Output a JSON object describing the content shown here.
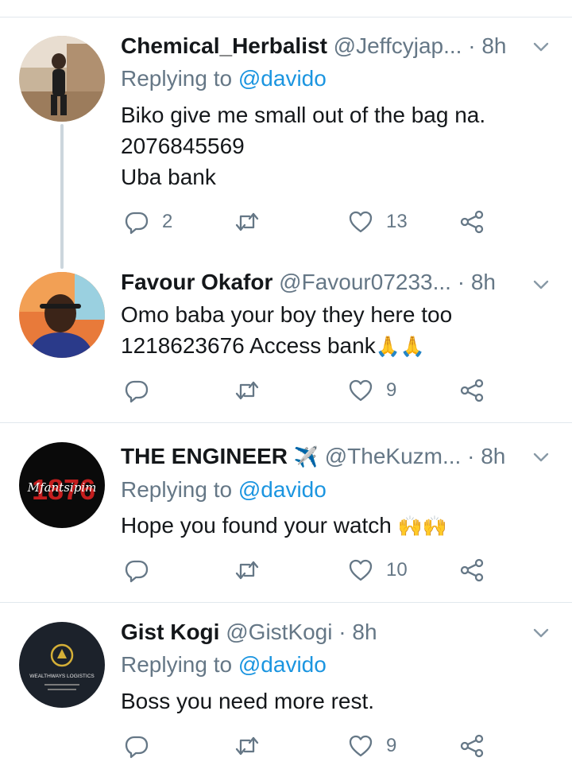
{
  "tweets": [
    {
      "name": "Chemical_Herbalist",
      "handle": "@Jeffcyjap...",
      "dot": " · ",
      "time": "8h",
      "replying_prefix": "Replying to ",
      "replying_mention": "@davido",
      "lines": [
        "Biko give me small out of the bag na.",
        "2076845569",
        "Uba bank"
      ],
      "reply_count": "2",
      "retweet_count": "",
      "like_count": "13"
    },
    {
      "name": "Favour Okafor",
      "handle": "@Favour07233...",
      "dot": " · ",
      "time": "8h",
      "lines": [
        "Omo baba your boy they here too",
        "1218623676 Access bank"
      ],
      "line2_emoji": "🙏🙏",
      "reply_count": "",
      "retweet_count": "",
      "like_count": "9"
    },
    {
      "name": "THE ENGINEER",
      "name_emoji": "✈️",
      "handle": "@TheKuzm...",
      "dot": " · ",
      "time": "8h",
      "replying_prefix": "Replying to ",
      "replying_mention": "@davido",
      "lines": [
        "Hope you found your watch"
      ],
      "line1_emoji": "🙌🙌",
      "reply_count": "",
      "retweet_count": "",
      "like_count": "10",
      "avatar_text": "Mfantsipim"
    },
    {
      "name": "Gist Kogi",
      "handle": "@GistKogi",
      "dot": " · ",
      "time": "8h",
      "replying_prefix": "Replying to ",
      "replying_mention": "@davido",
      "lines": [
        "Boss you need more rest."
      ],
      "reply_count": "",
      "retweet_count": "",
      "like_count": "9",
      "avatar_text": "WEALTHWAYS LOGISTICS"
    }
  ],
  "icons": {
    "reply": "reply-icon",
    "retweet": "retweet-icon",
    "like": "heart-icon",
    "share": "share-icon",
    "more": "chevron-down-icon"
  },
  "colors": {
    "text": "#14171a",
    "secondary": "#657786",
    "link": "#1b95e0",
    "divider": "#e1e8ed",
    "thread_line": "#ccd6dd"
  }
}
